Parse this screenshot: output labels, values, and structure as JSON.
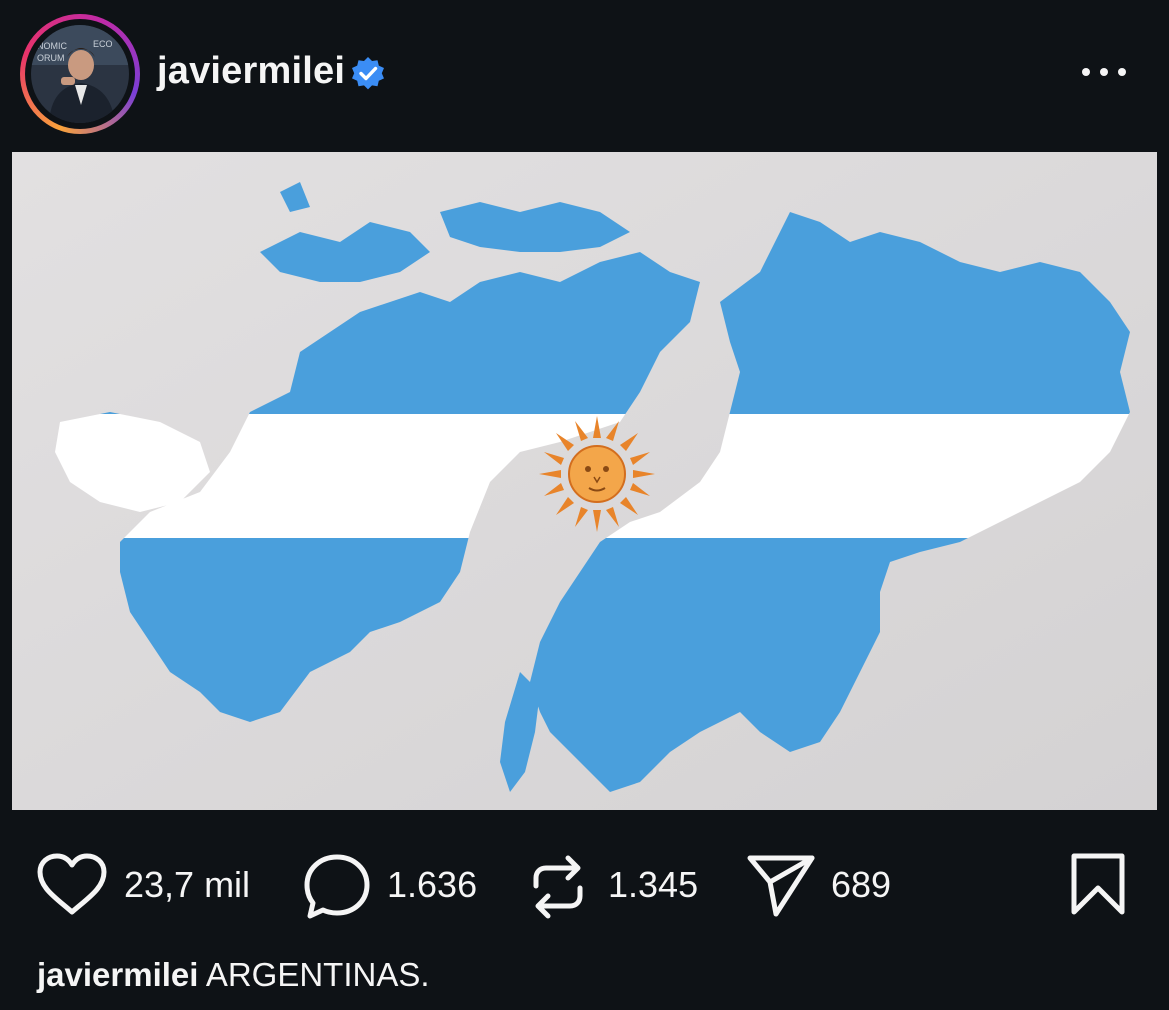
{
  "post": {
    "username": "javiermilei",
    "verified": true,
    "avatar_icon": "avatar-photo",
    "more_icon": "more-options-icon",
    "image_description_colors": {
      "sky_blue": "#4a9fdc",
      "white": "#ffffff",
      "sun": "#e8842a",
      "background": "#dcdadb"
    }
  },
  "actions": {
    "likes": "23,7 mil",
    "comments": "1.636",
    "reposts": "1.345",
    "shares": "689"
  },
  "caption": {
    "username": "javiermilei",
    "text": "ARGENTINAS."
  },
  "colors": {
    "background": "#0e1216",
    "text": "#f5f5f5",
    "verified": "#3b8df5"
  }
}
